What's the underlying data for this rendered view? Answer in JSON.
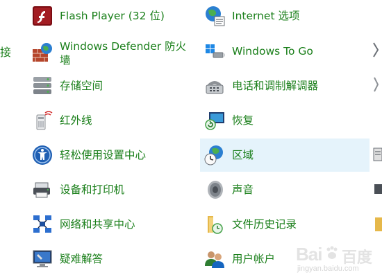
{
  "left_edge_fragment": "接",
  "col1": [
    {
      "label": "Flash Player (32 位)"
    },
    {
      "label": "Windows Defender 防火墙"
    },
    {
      "label": "存储空间"
    },
    {
      "label": "红外线"
    },
    {
      "label": "轻松使用设置中心"
    },
    {
      "label": "设备和打印机"
    },
    {
      "label": "网络和共享中心"
    },
    {
      "label": "疑难解答"
    }
  ],
  "col2": [
    {
      "label": "Internet 选项"
    },
    {
      "label": "Windows To Go"
    },
    {
      "label": "电话和调制解调器"
    },
    {
      "label": "恢复"
    },
    {
      "label": "区域"
    },
    {
      "label": "声音"
    },
    {
      "label": "文件历史记录"
    },
    {
      "label": "用户帐户"
    }
  ],
  "watermark": {
    "brand": "Bai",
    "brand2": "百度",
    "sub": "jingyan.baidu.com"
  },
  "colors": {
    "link": "#1a7f1a",
    "selected": "#e5f3fb"
  }
}
